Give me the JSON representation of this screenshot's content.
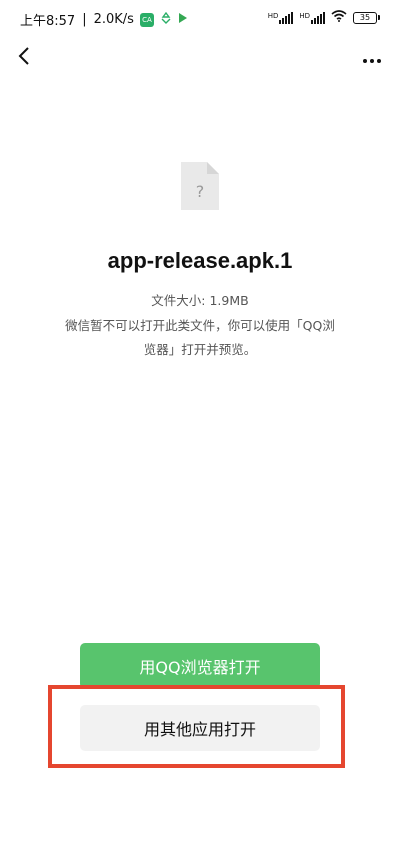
{
  "status_bar": {
    "time": "上午8:57",
    "separator": "|",
    "speed": "2.0K/s",
    "badge_text": "CA",
    "network_label_1": "HD",
    "network_label_2": "HD",
    "battery": "35"
  },
  "top_bar": {
    "back_icon": "chevron-left-icon",
    "more_icon": "more-dots-icon"
  },
  "file": {
    "icon": "unknown-file-icon",
    "name": "app-release.apk.1",
    "size": "文件大小: 1.9MB",
    "description": "微信暂不可以打开此类文件，你可以使用「QQ浏览器」打开并预览。"
  },
  "buttons": {
    "open_qq": "用QQ浏览器打开",
    "open_other": "用其他应用打开"
  },
  "colors": {
    "primary_button": "#58c46d",
    "secondary_button": "#f2f2f2",
    "highlight": "#e5462f"
  }
}
